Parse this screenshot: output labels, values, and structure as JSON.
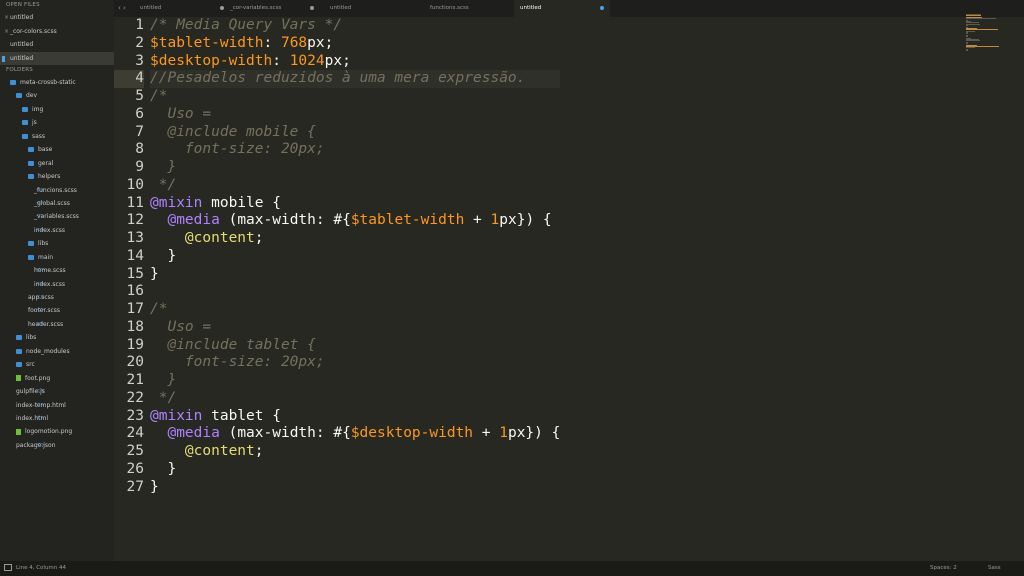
{
  "sidebar": {
    "open_files_header": "OPEN FILES",
    "open_files": [
      {
        "label": "untitled",
        "active": false,
        "closable": true
      },
      {
        "label": "_cor-colors.scss",
        "active": false,
        "closable": true
      },
      {
        "label": "untitled",
        "active": false,
        "closable": false
      },
      {
        "label": "untitled",
        "active": true,
        "closable": false
      }
    ],
    "folders_header": "FOLDERS",
    "tree": [
      {
        "label": "meta-crossb-static",
        "indent": 0,
        "icon": "folder"
      },
      {
        "label": "dev",
        "indent": 1,
        "icon": "folder"
      },
      {
        "label": "img",
        "indent": 2,
        "icon": "folder"
      },
      {
        "label": "js",
        "indent": 2,
        "icon": "folder"
      },
      {
        "label": "sass",
        "indent": 2,
        "icon": "folder"
      },
      {
        "label": "base",
        "indent": 3,
        "icon": "folder"
      },
      {
        "label": "geral",
        "indent": 3,
        "icon": "folder"
      },
      {
        "label": "helpers",
        "indent": 3,
        "icon": "folder"
      },
      {
        "label": "_funcions.scss",
        "indent": 4,
        "icon": "code"
      },
      {
        "label": "_global.scss",
        "indent": 4,
        "icon": "code"
      },
      {
        "label": "_variables.scss",
        "indent": 4,
        "icon": "code"
      },
      {
        "label": "index.scss",
        "indent": 4,
        "icon": "code"
      },
      {
        "label": "libs",
        "indent": 3,
        "icon": "folder"
      },
      {
        "label": "main",
        "indent": 3,
        "icon": "folder"
      },
      {
        "label": "home.scss",
        "indent": 4,
        "icon": "code"
      },
      {
        "label": "index.scss",
        "indent": 4,
        "icon": "code"
      },
      {
        "label": "app.scss",
        "indent": 3,
        "icon": "code"
      },
      {
        "label": "footer.scss",
        "indent": 3,
        "icon": "code"
      },
      {
        "label": "header.scss",
        "indent": 3,
        "icon": "code"
      },
      {
        "label": "libs",
        "indent": 1,
        "icon": "folder"
      },
      {
        "label": "node_modules",
        "indent": 1,
        "icon": "folder"
      },
      {
        "label": "src",
        "indent": 1,
        "icon": "folder"
      },
      {
        "label": "foot.png",
        "indent": 1,
        "icon": "file-img"
      },
      {
        "label": "gulpfile.js",
        "indent": 1,
        "icon": "code"
      },
      {
        "label": "index-temp.html",
        "indent": 1,
        "icon": "code"
      },
      {
        "label": "index.html",
        "indent": 1,
        "icon": "code"
      },
      {
        "label": "logomotion.png",
        "indent": 1,
        "icon": "file-img"
      },
      {
        "label": "package.json",
        "indent": 1,
        "icon": "code"
      }
    ]
  },
  "tabbar": {
    "nav": "‹ ›",
    "tabs": [
      {
        "label": "untitled",
        "active": false,
        "dirty": true
      },
      {
        "label": "_cor-variables.scss",
        "active": false,
        "dirty": true
      },
      {
        "label": "untitled",
        "active": false,
        "dirty": false
      },
      {
        "label": "functions.scss",
        "active": false,
        "dirty": false
      },
      {
        "label": "untitled",
        "active": true,
        "dirty": true
      }
    ]
  },
  "editor": {
    "current_line": 4,
    "lines": [
      [
        {
          "t": "/* Media Query Vars */",
          "c": "com"
        }
      ],
      [
        {
          "t": "$tablet-width",
          "c": "var"
        },
        {
          "t": ": ",
          "c": "pl"
        },
        {
          "t": "768",
          "c": "num"
        },
        {
          "t": "px;",
          "c": "pl"
        }
      ],
      [
        {
          "t": "$desktop-width",
          "c": "var"
        },
        {
          "t": ": ",
          "c": "pl"
        },
        {
          "t": "1024",
          "c": "num"
        },
        {
          "t": "px;",
          "c": "pl"
        }
      ],
      [
        {
          "t": "//Pesadelos reduzidos à uma mera expressão.",
          "c": "com"
        }
      ],
      [
        {
          "t": "/*",
          "c": "com"
        }
      ],
      [
        {
          "t": "  Uso =",
          "c": "com"
        }
      ],
      [
        {
          "t": "  @include mobile {",
          "c": "com"
        }
      ],
      [
        {
          "t": "    font-size: 20px;",
          "c": "com"
        }
      ],
      [
        {
          "t": "  }",
          "c": "com"
        }
      ],
      [
        {
          "t": " */",
          "c": "com"
        }
      ],
      [
        {
          "t": "@mixin",
          "c": "at"
        },
        {
          "t": " mobile {",
          "c": "pl"
        }
      ],
      [
        {
          "t": "  ",
          "c": "pl"
        },
        {
          "t": "@media",
          "c": "at"
        },
        {
          "t": " (max-width: #{",
          "c": "pl"
        },
        {
          "t": "$tablet-width",
          "c": "var"
        },
        {
          "t": " + ",
          "c": "pl"
        },
        {
          "t": "1",
          "c": "num"
        },
        {
          "t": "px}) {",
          "c": "pl"
        }
      ],
      [
        {
          "t": "    ",
          "c": "pl"
        },
        {
          "t": "@content",
          "c": "str"
        },
        {
          "t": ";",
          "c": "pl"
        }
      ],
      [
        {
          "t": "  }",
          "c": "pl"
        }
      ],
      [
        {
          "t": "}",
          "c": "pl"
        }
      ],
      [
        {
          "t": "",
          "c": "pl"
        }
      ],
      [
        {
          "t": "/*",
          "c": "com"
        }
      ],
      [
        {
          "t": "  Uso =",
          "c": "com"
        }
      ],
      [
        {
          "t": "  @include tablet {",
          "c": "com"
        }
      ],
      [
        {
          "t": "    font-size: 20px;",
          "c": "com"
        }
      ],
      [
        {
          "t": "  }",
          "c": "com"
        }
      ],
      [
        {
          "t": " */",
          "c": "com"
        }
      ],
      [
        {
          "t": "@mixin",
          "c": "at"
        },
        {
          "t": " tablet {",
          "c": "pl"
        }
      ],
      [
        {
          "t": "  ",
          "c": "pl"
        },
        {
          "t": "@media",
          "c": "at"
        },
        {
          "t": " (max-width: #{",
          "c": "pl"
        },
        {
          "t": "$desktop-width",
          "c": "var"
        },
        {
          "t": " + ",
          "c": "pl"
        },
        {
          "t": "1",
          "c": "num"
        },
        {
          "t": "px}) {",
          "c": "pl"
        }
      ],
      [
        {
          "t": "    ",
          "c": "pl"
        },
        {
          "t": "@content",
          "c": "str"
        },
        {
          "t": ";",
          "c": "pl"
        }
      ],
      [
        {
          "t": "  }",
          "c": "pl"
        }
      ],
      [
        {
          "t": "}",
          "c": "pl"
        }
      ]
    ]
  },
  "statusbar": {
    "position": "Line 4, Column 44",
    "spaces": "Spaces: 2",
    "syntax": "Sass"
  },
  "colors": {
    "background": "#272822",
    "comment": "#75715e",
    "variable": "#fd971f",
    "at_rule": "#ae81ff",
    "accent": "#4aa3e8"
  }
}
